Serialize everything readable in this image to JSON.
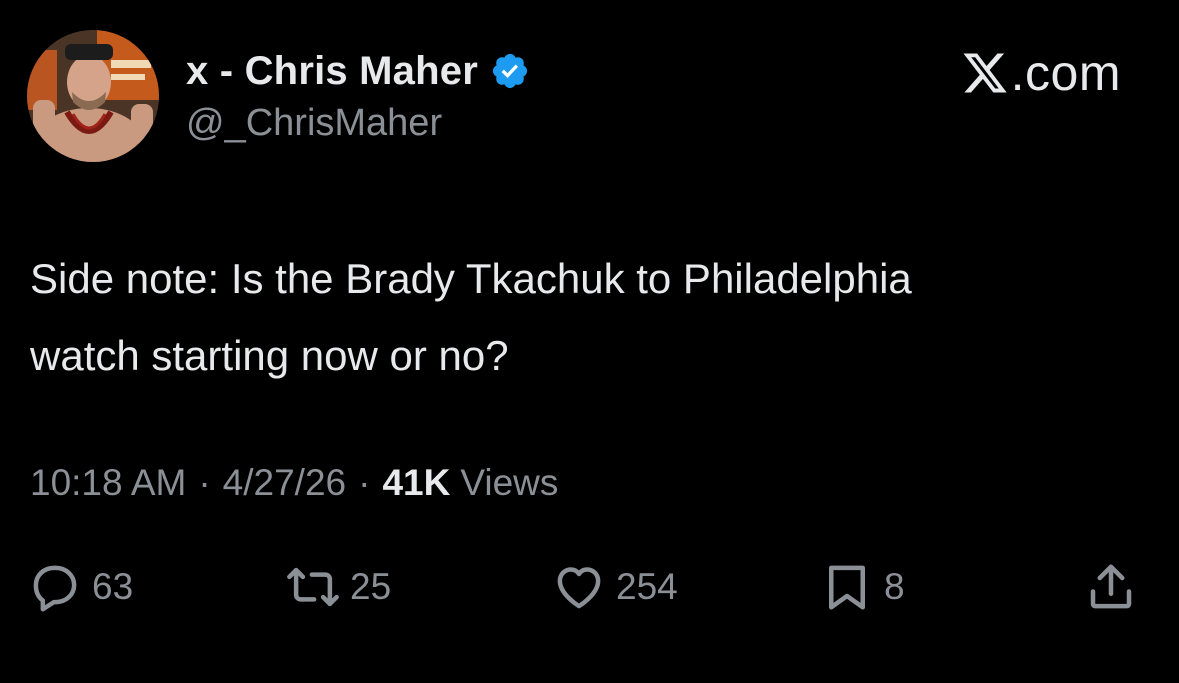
{
  "author": {
    "display_name": "x - Chris Maher",
    "handle": "@_ChrisMaher",
    "verified": true,
    "avatar_icon": "profile-photo"
  },
  "brand": {
    "label": ".com",
    "logo_icon": "x-logo-icon"
  },
  "tweet": {
    "text": "Side note: Is the Brady Tkachuk to Philadelphia\nwatch starting now or no?",
    "time": "10:18 AM",
    "date": "4/27/26",
    "separator": "·",
    "views_count": "41K",
    "views_label": "Views"
  },
  "actions": {
    "reply": {
      "icon": "reply-icon",
      "count": "63"
    },
    "repost": {
      "icon": "repost-icon",
      "count": "25"
    },
    "like": {
      "icon": "heart-icon",
      "count": "254"
    },
    "bookmark": {
      "icon": "bookmark-icon",
      "count": "8"
    },
    "share": {
      "icon": "share-icon"
    }
  },
  "colors": {
    "background": "#000000",
    "primary_text": "#e7e9ea",
    "secondary_text": "#8b9096",
    "verified_badge": "#1d9bf0"
  }
}
